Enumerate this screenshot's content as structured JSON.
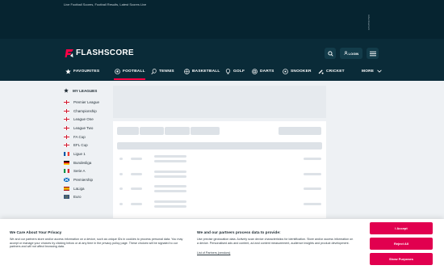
{
  "topbar": {
    "tagline": "Live Football Scores, Football Results, Latest Scores Live",
    "advertisement": "Advertisement"
  },
  "header": {
    "logo_text": "FLASHSCORE",
    "login_label": "LOGIN",
    "search_icon": "search-icon",
    "menu_icon": "hamburger-icon"
  },
  "nav": {
    "items": [
      {
        "label": "FAVOURITES",
        "icon": "star-icon"
      },
      {
        "label": "FOOTBALL",
        "icon": "football-icon"
      },
      {
        "label": "TENNIS",
        "icon": "tennis-icon"
      },
      {
        "label": "BASKETBALL",
        "icon": "basketball-icon"
      },
      {
        "label": "GOLF",
        "icon": "golf-icon"
      },
      {
        "label": "DARTS",
        "icon": "darts-icon"
      },
      {
        "label": "SNOOKER",
        "icon": "snooker-icon"
      },
      {
        "label": "CRICKET",
        "icon": "cricket-icon"
      }
    ],
    "more_label": "MORE"
  },
  "sidebar": {
    "title": "MY LEAGUES",
    "leagues": [
      {
        "label": "Premier League",
        "flag": "england"
      },
      {
        "label": "Championship",
        "flag": "england"
      },
      {
        "label": "League One",
        "flag": "england"
      },
      {
        "label": "League Two",
        "flag": "england"
      },
      {
        "label": "FA Cup",
        "flag": "england"
      },
      {
        "label": "EFL Cup",
        "flag": "england"
      },
      {
        "label": "Ligue 1",
        "flag": "france"
      },
      {
        "label": "Bundesliga",
        "flag": "germany"
      },
      {
        "label": "Serie A",
        "flag": "italy"
      },
      {
        "label": "Premiership",
        "flag": "scotland"
      },
      {
        "label": "LaLiga",
        "flag": "spain"
      },
      {
        "label": "Euro",
        "flag": "europe"
      }
    ]
  },
  "cookie": {
    "privacy_title": "We Care About Your Privacy",
    "privacy_text": "We and our partners store and/or access information on a device, such as unique IDs in cookies to process personal data. You may accept or manage your choices by clicking below or at any time in the privacy policy page. These choices will be signaled to our partners and will not affect browsing data.",
    "partners_title": "We and our partners process data to provide:",
    "partners_text": "Use precise geolocation data. Actively scan device characteristics for identification. Store and/or access information on a device. Personalised ads and content, ad and content measurement, audience insights and product development.",
    "partners_link": "List of Partners (vendors)",
    "accept_label": "I Accept",
    "reject_label": "Reject All",
    "purposes_label": "Show Purposes"
  },
  "colors": {
    "header_bg": "#0a2b38",
    "accent": "#ff0046",
    "button": "#e1004f"
  }
}
